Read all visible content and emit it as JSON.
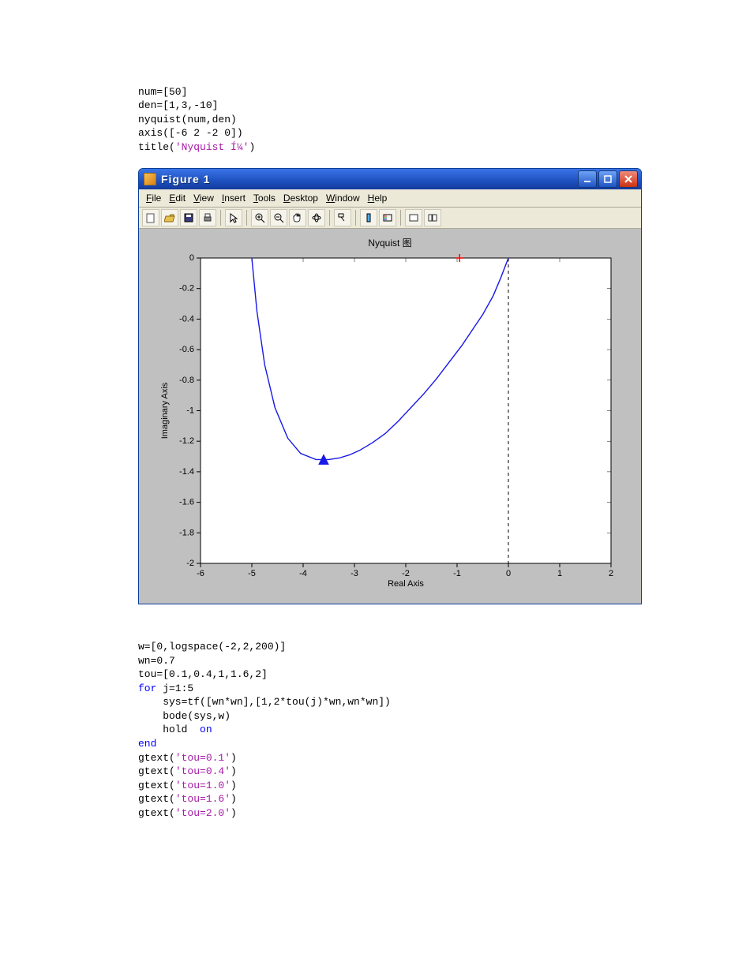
{
  "code1": {
    "line1": "num=[50]",
    "line2": "den=[1,3,-10]",
    "line3": "nyquist(num,den)",
    "line4": "axis([-6 2 -2 0])",
    "line5a": "title(",
    "line5b": "'Nyquist Í¼'",
    "line5c": ")"
  },
  "figure": {
    "title": "Figure 1",
    "menu": {
      "file": "File",
      "edit": "Edit",
      "view": "View",
      "insert": "Insert",
      "tools": "Tools",
      "desktop": "Desktop",
      "window": "Window",
      "help": "Help"
    },
    "plot_title": "Nyquist 图",
    "xlabel": "Real Axis",
    "ylabel": "Imaginary Axis"
  },
  "code2": {
    "line1": "w=[0,logspace(-2,2,200)]",
    "line2": "wn=0.7",
    "line3": "tou=[0.1,0.4,1,1.6,2]",
    "line4a": "for",
    "line4b": " j=1:5",
    "line5": "    sys=tf([wn*wn],[1,2*tou(j)*wn,wn*wn])",
    "line6": "    bode(sys,w)",
    "line7a": "    hold  ",
    "line7b": "on",
    "line8": "end",
    "line9a": "gtext(",
    "line9b": "'tou=0.1'",
    "line9c": ")",
    "line10a": "gtext(",
    "line10b": "'tou=0.4'",
    "line10c": ")",
    "line11a": "gtext(",
    "line11b": "'tou=1.0'",
    "line11c": ")",
    "line12a": "gtext(",
    "line12b": "'tou=1.6'",
    "line12c": ")",
    "line13a": "gtext(",
    "line13b": "'tou=2.0'",
    "line13c": ")"
  },
  "chart_data": {
    "type": "line",
    "title": "Nyquist 图",
    "xlabel": "Real Axis",
    "ylabel": "Imaginary Axis",
    "xlim": [
      -6,
      2
    ],
    "ylim": [
      -2,
      0
    ],
    "xticks": [
      -6,
      -5,
      -4,
      -3,
      -2,
      -1,
      0,
      1,
      2
    ],
    "yticks": [
      0,
      -0.2,
      -0.4,
      -0.6,
      -0.8,
      -1,
      -1.2,
      -1.4,
      -1.6,
      -1.8,
      -2
    ],
    "series": [
      {
        "name": "Nyquist curve",
        "color": "#1818e8",
        "x": [
          -5.0,
          -4.9,
          -4.75,
          -4.55,
          -4.3,
          -4.05,
          -3.75,
          -3.5,
          -3.3,
          -3.1,
          -2.9,
          -2.65,
          -2.4,
          -2.15,
          -1.9,
          -1.65,
          -1.4,
          -1.15,
          -0.9,
          -0.7,
          -0.5,
          -0.3,
          -0.15,
          0.0
        ],
        "y": [
          0.0,
          -0.35,
          -0.7,
          -0.98,
          -1.18,
          -1.28,
          -1.32,
          -1.32,
          -1.31,
          -1.29,
          -1.26,
          -1.21,
          -1.15,
          -1.07,
          -0.98,
          -0.89,
          -0.79,
          -0.68,
          -0.57,
          -0.47,
          -0.37,
          -0.25,
          -0.13,
          0.0
        ]
      }
    ],
    "markers": [
      {
        "name": "triangle",
        "shape": "triangle",
        "color": "#1818e8",
        "x": -3.6,
        "y": -1.32
      },
      {
        "name": "cross",
        "shape": "plus",
        "color": "#ff0000",
        "x": -0.95,
        "y": 0.0
      }
    ],
    "annotations": [
      {
        "name": "vertical-dash-at-zero",
        "type": "vline",
        "x": 0,
        "style": "dashed",
        "color": "#000000"
      }
    ]
  }
}
